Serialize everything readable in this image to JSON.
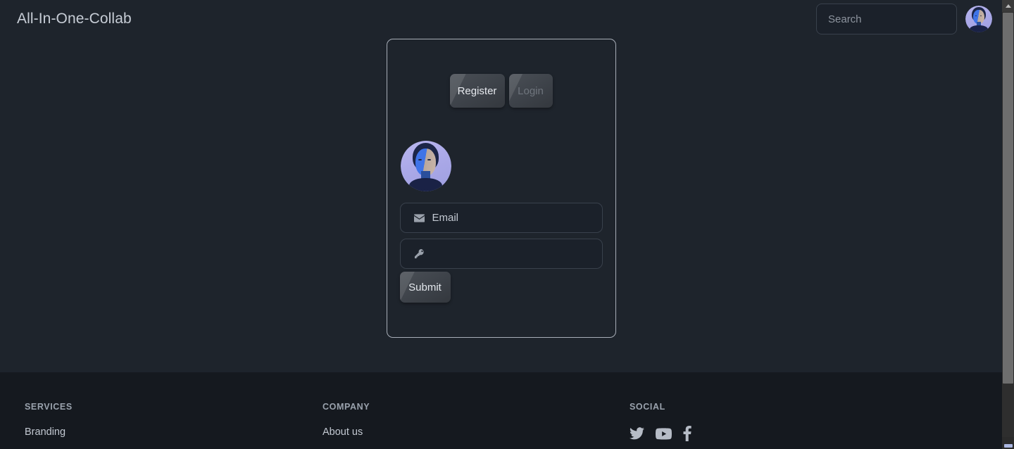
{
  "header": {
    "brand": "All-In-One-Collab",
    "search": {
      "placeholder": "Search",
      "value": ""
    },
    "avatar_name": "user-avatar"
  },
  "auth_card": {
    "tabs": [
      {
        "label": "Register",
        "active": true
      },
      {
        "label": "Login",
        "active": false
      }
    ],
    "avatar_name": "profile-avatar",
    "fields": [
      {
        "name": "email",
        "icon": "envelope-icon",
        "placeholder": "Email",
        "value": ""
      },
      {
        "name": "password",
        "icon": "key-icon",
        "placeholder": "",
        "value": ""
      }
    ],
    "submit_label": "Submit"
  },
  "footer": {
    "columns": [
      {
        "heading": "SERVICES",
        "links": [
          "Branding"
        ]
      },
      {
        "heading": "COMPANY",
        "links": [
          "About us"
        ]
      },
      {
        "heading": "SOCIAL",
        "links": []
      }
    ],
    "social_icons": [
      "twitter-icon",
      "youtube-icon",
      "facebook-icon"
    ]
  },
  "colors": {
    "page_bg": "#1e242c",
    "footer_bg": "#15191f",
    "card_border": "#a8aeb8",
    "input_border": "#39414c",
    "text_primary": "#c7cdd6",
    "text_muted": "#8d949e",
    "button_face": "#3d4249",
    "avatar_accent": "#3f74e8"
  },
  "scrollbar": {
    "position_percent": 0,
    "thumb_height_percent": 87
  }
}
